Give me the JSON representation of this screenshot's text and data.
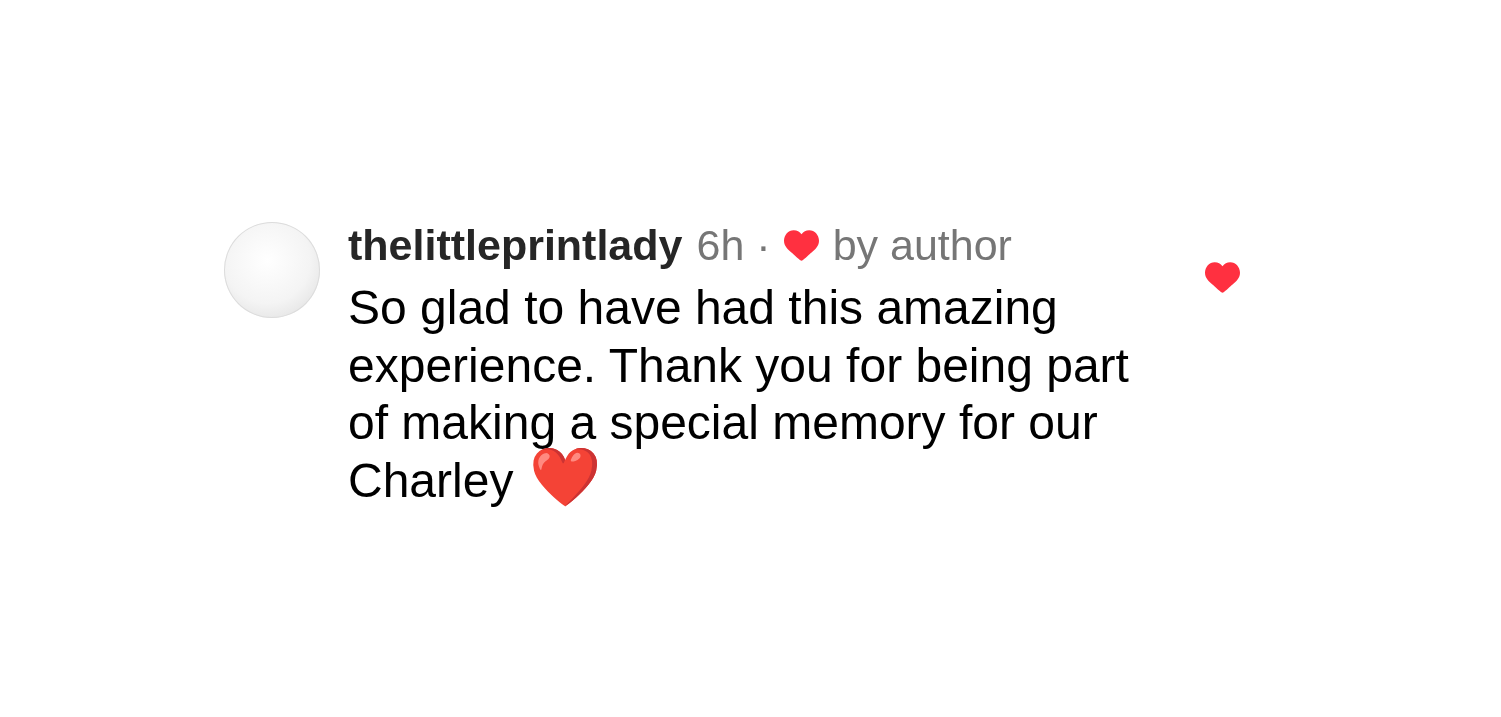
{
  "comment": {
    "username": "thelittleprintlady",
    "time": "6h",
    "separator": "·",
    "liked_by_author": true,
    "author_like_label": "by author",
    "text": "So glad to have had this amazing experience. Thank you for being part of making a special memory for our Charley",
    "emoji": "❤️",
    "liked": true
  }
}
